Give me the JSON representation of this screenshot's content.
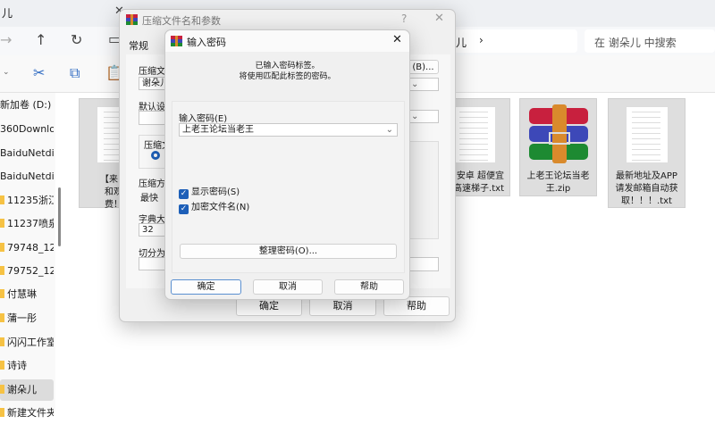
{
  "explorer": {
    "tab_title": "儿",
    "address_tail": "儿",
    "search_placeholder": "在 谢朵儿 中搜索",
    "sidebar": [
      "新加卷 (D:)",
      "360Downloa",
      "BaiduNetdis",
      "BaiduNetdis",
      "11235浙江",
      "11237喷泉",
      "79748_123",
      "79752_123",
      "付慧琳",
      "蒲一彤",
      "闪闪工作室",
      "诗诗",
      "谢朵儿",
      "新建文件夹"
    ],
    "selected_sidebar": "谢朵儿",
    "files": [
      {
        "name": "【来了就\n和观看\n费！】",
        "type": "txt"
      },
      {
        "name": "安卓 超便宜\n高速梯子.txt",
        "type": "txt"
      },
      {
        "name": "上老王论坛当老\n王.zip",
        "type": "zip"
      },
      {
        "name": "最新地址及APP\n请发邮箱自动获\n取！！！.txt",
        "type": "txt"
      }
    ]
  },
  "archive_dialog": {
    "title": "压缩文件名和参数",
    "help_glyph": "?",
    "tab_general": "常规",
    "label_archive_name": "压缩文",
    "archive_name_value": "谢朵儿",
    "browse_button": "(B)...",
    "label_default": "默认设",
    "label_format": "压缩文",
    "label_method": "压缩方",
    "method_value": "最快",
    "label_dict": "字典大",
    "dict_value": "32",
    "label_split": "切分为",
    "ok": "确定",
    "cancel": "取消",
    "help": "帮助"
  },
  "password_dialog": {
    "title": "输入密码",
    "info_line1": "已输入密码标签。",
    "info_line2": "将使用匹配此标签的密码。",
    "label_password": "输入密码(E)",
    "password_value": "上老王论坛当老王",
    "show_password": "显示密码(S)",
    "show_password_checked": true,
    "encrypt_names": "加密文件名(N)",
    "encrypt_names_checked": true,
    "organize_button": "整理密码(O)...",
    "ok": "确定",
    "cancel": "取消",
    "help": "帮助"
  }
}
